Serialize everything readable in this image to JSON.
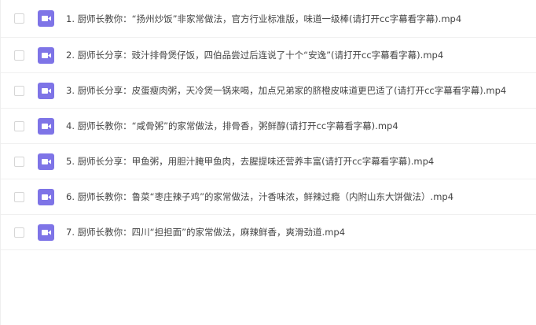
{
  "files": [
    {
      "name": "1. 厨师长教你：“扬州炒饭”非家常做法，官方行业标准版，味道一级棒(请打开cc字幕看字幕).mp4",
      "icon": "video-file-icon"
    },
    {
      "name": "2. 厨师长分享：豉汁排骨煲仔饭，四伯品尝过后连说了十个“安逸”(请打开cc字幕看字幕).mp4",
      "icon": "video-file-icon"
    },
    {
      "name": "3. 厨师长分享：皮蛋瘦肉粥，天冷煲一锅来喝，加点兄弟家的脐橙皮味道更巴适了(请打开cc字幕看字幕).mp4",
      "icon": "video-file-icon"
    },
    {
      "name": "4. 厨师长教你：“咸骨粥”的家常做法，排骨香，粥鲜醇(请打开cc字幕看字幕).mp4",
      "icon": "video-file-icon"
    },
    {
      "name": "5. 厨师长分享：甲鱼粥，用胆汁腌甲鱼肉，去腥提味还营养丰富(请打开cc字幕看字幕).mp4",
      "icon": "video-file-icon"
    },
    {
      "name": "6. 厨师长教你：鲁菜“枣庄辣子鸡”的家常做法，汁香味浓，鲜辣过瘾（内附山东大饼做法）.mp4",
      "icon": "video-file-icon"
    },
    {
      "name": "7. 厨师长教你：四川“担担面”的家常做法，麻辣鲜香，爽滑劲道.mp4",
      "icon": "video-file-icon"
    }
  ],
  "colors": {
    "icon_bg": "#7e74e7",
    "row_divider": "#f0f0f0",
    "text": "#444444"
  }
}
